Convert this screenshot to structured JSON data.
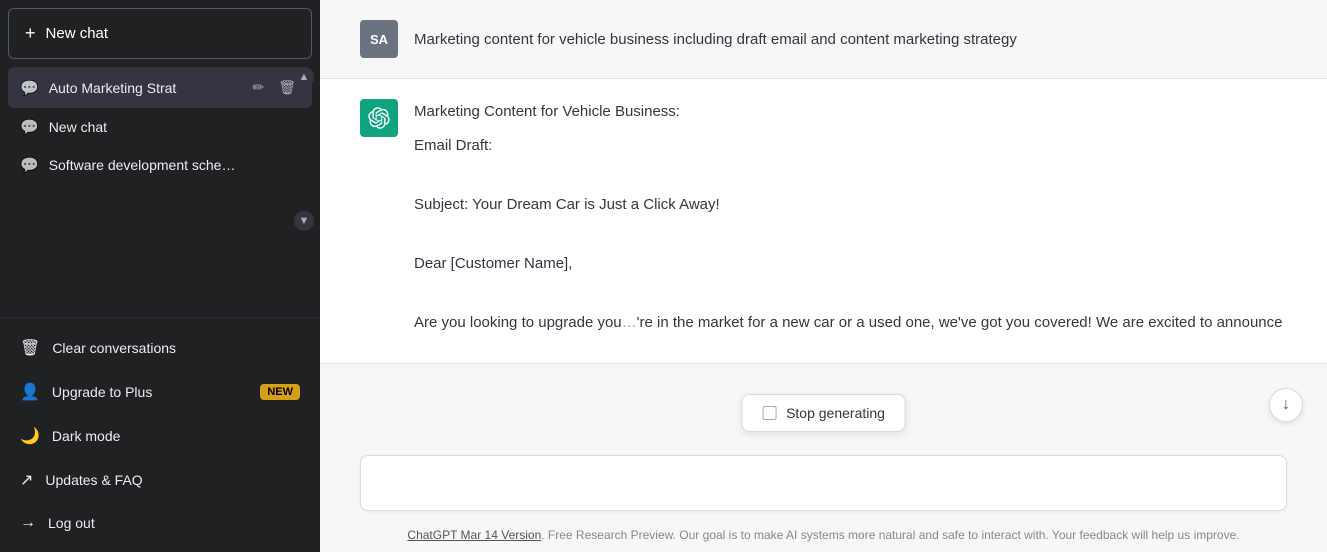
{
  "sidebar": {
    "new_chat_label": "New chat",
    "conversations": [
      {
        "id": "auto-marketing",
        "label": "Auto Marketing Strat",
        "active": true
      },
      {
        "id": "new-chat",
        "label": "New chat",
        "active": false
      },
      {
        "id": "software-dev",
        "label": "Software development sche…",
        "active": false
      }
    ],
    "actions": [
      {
        "id": "clear",
        "icon": "🗑",
        "label": "Clear conversations"
      },
      {
        "id": "upgrade",
        "icon": "👤",
        "label": "Upgrade to Plus",
        "badge": "NEW"
      },
      {
        "id": "dark-mode",
        "icon": "🌙",
        "label": "Dark mode"
      },
      {
        "id": "updates",
        "icon": "↗",
        "label": "Updates & FAQ"
      },
      {
        "id": "logout",
        "icon": "→",
        "label": "Log out"
      }
    ]
  },
  "chat": {
    "user_avatar": "SA",
    "user_message": "Marketing content for vehicle business including draft email and content marketing strategy",
    "assistant_heading": "Marketing Content for Vehicle Business:",
    "assistant_lines": [
      "Email Draft:",
      "",
      "Subject: Your Dream Car is Just a Click Away!",
      "",
      "Dear [Customer Name],",
      "",
      "Are you looking to upgrade you…'re in the market for a new car or a used one, we've got you covered! We are excited to announce"
    ],
    "stop_generating_label": "Stop generating",
    "input_placeholder": "",
    "footer_link": "ChatGPT Mar 14 Version",
    "footer_text": ". Free Research Preview. Our goal is to make AI systems more natural and safe to interact with. Your feedback will help us improve."
  },
  "icons": {
    "plus": "+",
    "chat_bubble": "◻",
    "edit": "✏",
    "delete": "🗑",
    "scroll_up": "▲",
    "scroll_down": "▼",
    "scroll_to_bottom": "↓",
    "gpt_icon": "✦"
  }
}
